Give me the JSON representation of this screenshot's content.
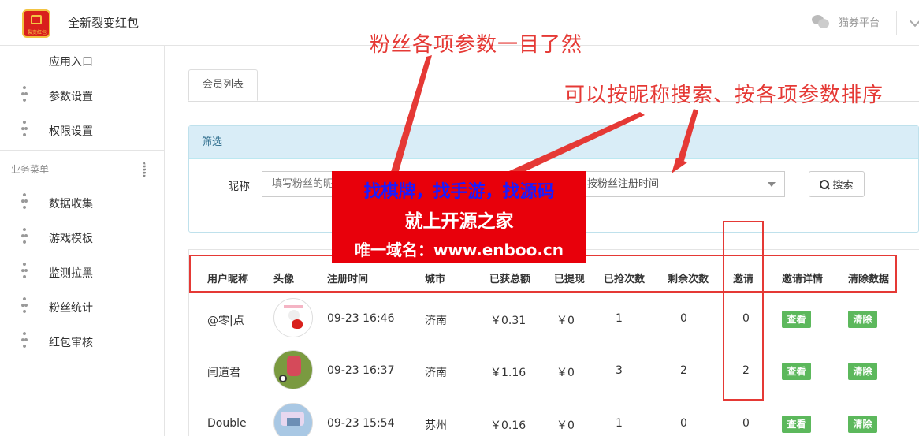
{
  "header": {
    "app_title": "全新裂变红包",
    "logo_text": "裂变红包",
    "platform_label": "猫券平台"
  },
  "sidebar": {
    "top_items": [
      {
        "label": "应用入口",
        "icon": "chat-icon"
      },
      {
        "label": "参数设置",
        "icon": "gear-icon"
      },
      {
        "label": "权限设置",
        "icon": "gear-icon"
      }
    ],
    "group_title": "业务菜单",
    "business_items": [
      {
        "label": "数据收集",
        "icon": "gear-icon"
      },
      {
        "label": "游戏模板",
        "icon": "gear-icon"
      },
      {
        "label": "监测拉黑",
        "icon": "gear-icon"
      },
      {
        "label": "粉丝统计",
        "icon": "gear-icon"
      },
      {
        "label": "红包审核",
        "icon": "gear-icon"
      }
    ]
  },
  "main": {
    "tab_label": "会员列表",
    "filter": {
      "panel_title": "筛选",
      "nickname_label": "昵称",
      "nickname_placeholder": "填写粉丝的昵称",
      "sort_selected": "按粉丝注册时间",
      "search_label": "搜索"
    },
    "table": {
      "headers": [
        "用户昵称",
        "头像",
        "注册时间",
        "城市",
        "已获总额",
        "已提现",
        "已抢次数",
        "剩余次数",
        "邀请",
        "邀请详情",
        "清除数据"
      ],
      "rows": [
        {
          "nickname": "@零|点",
          "reg_time": "09-23 16:46",
          "city": "济南",
          "total": "￥0.31",
          "withdrawn": "￥0",
          "grabbed": "1",
          "remaining": "0",
          "invites": "0",
          "detail_btn": "查看",
          "clear_btn": "清除"
        },
        {
          "nickname": "闫道君",
          "reg_time": "09-23 16:37",
          "city": "济南",
          "total": "￥1.16",
          "withdrawn": "￥0",
          "grabbed": "3",
          "remaining": "2",
          "invites": "2",
          "detail_btn": "查看",
          "clear_btn": "清除"
        },
        {
          "nickname": "Double",
          "reg_time": "09-23 15:54",
          "city": "苏州",
          "total": "￥0.16",
          "withdrawn": "￥0",
          "grabbed": "1",
          "remaining": "0",
          "invites": "0",
          "detail_btn": "查看",
          "clear_btn": "清除"
        }
      ]
    }
  },
  "annotations": {
    "note1": "粉丝各项参数一目了然",
    "note2": "可以按昵称搜索、按各项参数排序",
    "accent_color": "#e53935"
  },
  "watermark": {
    "line1": "找棋牌，找手游，找源码",
    "line2": "就上开源之家",
    "line3": "唯一域名：www.enboo.cn"
  },
  "colors": {
    "button_green": "#5cb85c",
    "filter_header_bg": "#d9edf7",
    "watermark_red": "#e8000b"
  }
}
